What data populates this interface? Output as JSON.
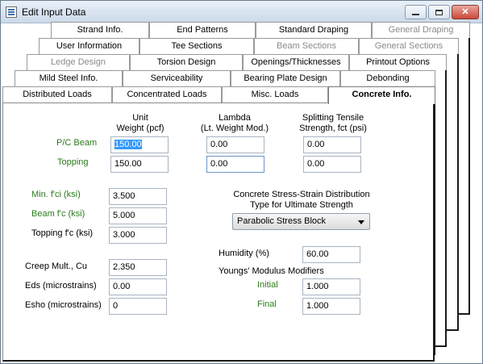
{
  "window": {
    "title": "Edit Input Data",
    "controls": {
      "minimize": "",
      "maximize": "",
      "close": "✕"
    }
  },
  "tabs": {
    "row1": [
      "Strand Info.",
      "End Patterns",
      "Standard Draping",
      "General Draping"
    ],
    "row2": [
      "User Information",
      "Tee Sections",
      "Beam Sections",
      "General Sections"
    ],
    "row3": [
      "Ledge Design",
      "Torsion Design",
      "Openings/Thicknesses",
      "Printout Options"
    ],
    "row4": [
      "Mild Steel Info.",
      "Serviceability",
      "Bearing Plate Design",
      "Debonding"
    ],
    "row5": [
      "Distributed Loads",
      "Concentrated Loads",
      "Misc. Loads",
      "Concrete Info."
    ]
  },
  "concrete": {
    "headers": {
      "unit_weight": [
        "Unit",
        "Weight (pcf)"
      ],
      "lambda": [
        "Lambda",
        "(Lt. Weight Mod.)"
      ],
      "splitting": [
        "Splitting Tensile",
        "Strength, fct (psi)"
      ]
    },
    "rows": {
      "pc_beam": {
        "label": "P/C Beam",
        "unit_weight": "150.00",
        "lambda": "0.00",
        "splitting": "0.00"
      },
      "topping": {
        "label": "Topping",
        "unit_weight": "150.00",
        "lambda": "0.00",
        "splitting": "0.00"
      }
    },
    "strengths": {
      "min_fci": {
        "label": "Min. f'ci (ksi)",
        "value": "3.500"
      },
      "beam_fc": {
        "label": "Beam f'c (ksi)",
        "value": "5.000"
      },
      "topping_fc": {
        "label": "Topping f'c (ksi)",
        "value": "3.000"
      }
    },
    "stress_strain": {
      "title": [
        "Concrete Stress-Strain Distribution",
        "Type for Ultimate Strength"
      ],
      "selected": "Parabolic Stress Block"
    },
    "creep": {
      "creep_mult": {
        "label": "Creep Mult., Cu",
        "value": "2.350"
      },
      "eds": {
        "label": "Eds (microstrains)",
        "value": "0.00"
      },
      "esho": {
        "label": "Esho (microstrains)",
        "value": "0"
      }
    },
    "humidity": {
      "label": "Humidity (%)",
      "value": "60.00"
    },
    "youngs": {
      "title": "Youngs' Modulus Modifiers",
      "initial": {
        "label": "Initial",
        "value": "1.000"
      },
      "final": {
        "label": "Final",
        "value": "1.000"
      }
    }
  }
}
